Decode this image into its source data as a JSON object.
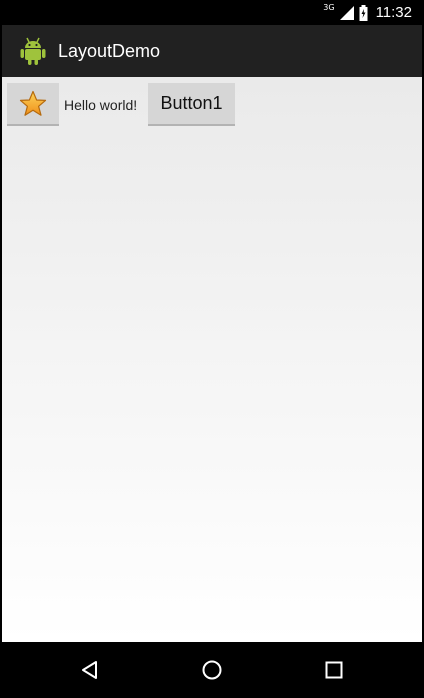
{
  "status_bar": {
    "network_label": "3G",
    "time": "11:32",
    "icons": [
      "signal-icon",
      "battery-icon"
    ]
  },
  "action_bar": {
    "app_icon": "android-robot-icon",
    "title": "LayoutDemo"
  },
  "content": {
    "image_button_icon": "star-icon",
    "hello_text": "Hello world!",
    "button1_label": "Button1"
  },
  "nav_bar": {
    "buttons": [
      "back-icon",
      "home-icon",
      "recents-icon"
    ]
  },
  "colors": {
    "status_bar_bg": "#000000",
    "action_bar_bg": "#212121",
    "content_bg_top": "#eaeaea",
    "content_bg_bottom": "#ffffff",
    "button_bg": "#d6d6d6",
    "star_fill": "#f7a81d",
    "android_green": "#9fc33c"
  }
}
